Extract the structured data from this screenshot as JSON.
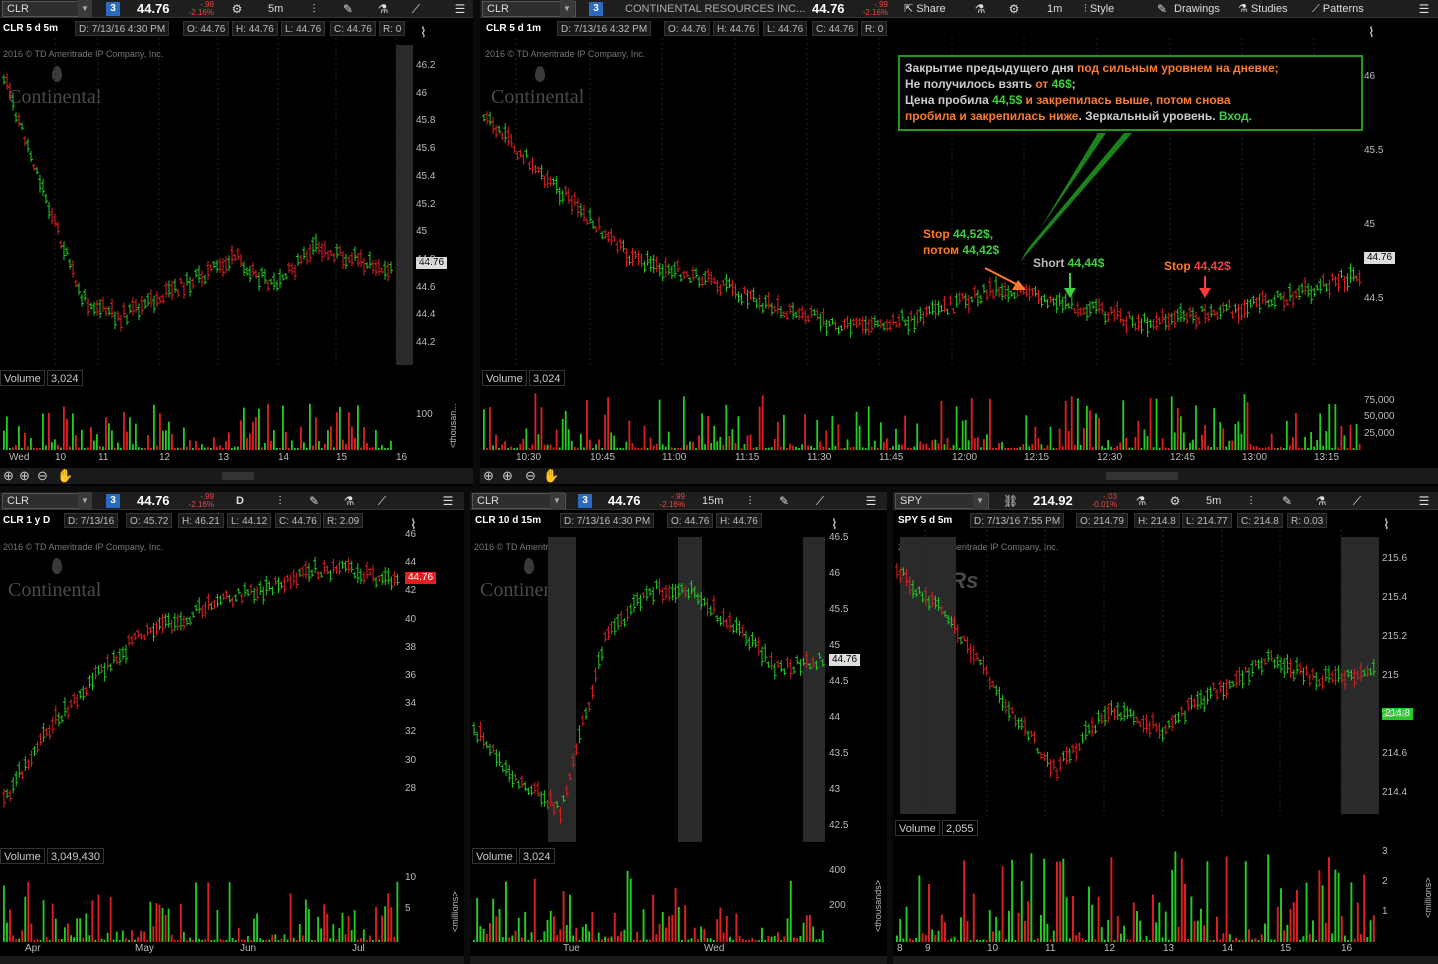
{
  "p1": {
    "symbol": "CLR",
    "link": "3",
    "price": "44.76",
    "chg1": "-.99",
    "chg2": "-2.16%",
    "tf": "5m",
    "label": "CLR 5 d 5m",
    "d": "D: 7/13/16 4:30 PM",
    "o": "O: 44.76",
    "h": "H: 44.76",
    "l": "L: 44.76",
    "c": "C: 44.76",
    "r": "R: 0",
    "copy": "2016 © TD Ameritrade IP Company, Inc.",
    "logo": "Continental",
    "yticks": [
      "46.2",
      "46",
      "45.8",
      "45.6",
      "45.4",
      "45.2",
      "45",
      "44.8",
      "44.6",
      "44.4",
      "44.2"
    ],
    "plabel": "44.76",
    "vol_label": "Volume",
    "vol_val": "3,024",
    "vol_ticks": [
      "100"
    ],
    "vol_unit": "<thousan...",
    "xlabels": [
      "Wed",
      "10",
      "11",
      "12",
      "13",
      "14",
      "15",
      "16"
    ]
  },
  "p2": {
    "symbol": "CLR",
    "link": "3",
    "company": "CONTINENTAL RESOURCES INC...",
    "price": "44.76",
    "chg1": "-.99",
    "chg2": "-2.16%",
    "menu": [
      "Share",
      "1m",
      "Style",
      "Drawings",
      "Studies",
      "Patterns"
    ],
    "label": "CLR 5 d 1m",
    "d": "D: 7/13/16 4:32 PM",
    "o": "O: 44.76",
    "h": "H: 44.76",
    "l": "L: 44.76",
    "c": "C: 44.76",
    "r": "R: 0",
    "copy": "2016 © TD Ameritrade IP Company, Inc.",
    "logo": "Continental",
    "yticks": [
      "46",
      "45.5",
      "45",
      "44.5"
    ],
    "plabel": "44.76",
    "vol_label": "Volume",
    "vol_val": "3,024",
    "vol_ticks": [
      "75,000",
      "50,000",
      "25,000"
    ],
    "xlabels": [
      "10:30",
      "10:45",
      "11:00",
      "11:15",
      "11:30",
      "11:45",
      "12:00",
      "12:15",
      "12:30",
      "12:45",
      "13:00",
      "13:15"
    ],
    "note": {
      "l1a": "Закрытие предыдущего дня ",
      "l1b": "под сильным уровнем на дневке;",
      "l2a": "Не получилось взять ",
      "l2b": "от ",
      "l2c": "46$",
      "l2d": ";",
      "l3a": "Цена пробила ",
      "l3b": "44,5$",
      "l3c": " и закрепилась выше, потом снова",
      "l4a": "пробила и закрепилась ниже",
      "l4b": ". Зеркальный уровень. ",
      "l4c": "Вход."
    },
    "stop1a": "Stop ",
    "stop1b": "44,52$,",
    "stop1c": "потом ",
    "stop1d": "44,42$",
    "short_a": "Short ",
    "short_b": "44,44$",
    "stop2a": "Stop ",
    "stop2b": "44,42$"
  },
  "p3": {
    "symbol": "CLR",
    "link": "3",
    "price": "44.76",
    "chg1": "-.99",
    "chg2": "-2.16%",
    "tf": "D",
    "label": "CLR 1 y D",
    "d": "D: 7/13/16",
    "o": "O: 45.72",
    "h": "H: 46.21",
    "l": "L: 44.12",
    "c": "C: 44.76",
    "r": "R: 2.09",
    "copy": "2016 © TD Ameritrade IP Company, Inc.",
    "logo": "Continental",
    "yticks": [
      "46",
      "44",
      "42",
      "40",
      "38",
      "36",
      "34",
      "32",
      "30",
      "28"
    ],
    "plabel": "44.76",
    "vol_label": "Volume",
    "vol_val": "3,049,430",
    "vol_ticks": [
      "10",
      "5"
    ],
    "vol_unit": "<millions>",
    "xlabels": [
      "Apr",
      "May",
      "Jun",
      "Jul"
    ]
  },
  "p4": {
    "symbol": "CLR",
    "link": "3",
    "price": "44.76",
    "chg1": "-.99",
    "chg2": "-2.16%",
    "tf": "15m",
    "label": "CLR 10 d 15m",
    "d": "D: 7/13/16 4:30 PM",
    "o": "O: 44.76",
    "h": "H: 44.76",
    "copy": "2016 © TD Ameritrade",
    "logo": "Continental",
    "yticks": [
      "46.5",
      "46",
      "45.5",
      "45",
      "44.5",
      "44",
      "43.5",
      "43",
      "42.5"
    ],
    "plabel": "44.76",
    "vol_label": "Volume",
    "vol_val": "3,024",
    "vol_ticks": [
      "400",
      "200"
    ],
    "vol_unit": "<thousands>",
    "xlabels": [
      "Tue",
      "Wed"
    ]
  },
  "p5": {
    "symbol": "SPY",
    "price": "214.92",
    "chg1": "-.03",
    "chg2": "-0.01%",
    "tf": "5m",
    "label": "SPY 5 d 5m",
    "d": "D: 7/13/16 7:55 PM",
    "o": "O: 214.79",
    "h": "H: 214.8",
    "l": "L: 214.77",
    "c": "C: 214.8",
    "r": "R: 0.03",
    "copy": "2016 © TD Ameritrade IP Company, Inc.",
    "logo": "SPDRs",
    "yticks": [
      "215.6",
      "215.4",
      "215.2",
      "215",
      "214.8",
      "214.6",
      "214.4"
    ],
    "plabel": "214.8",
    "vol_label": "Volume",
    "vol_val": "2,055",
    "vol_ticks": [
      "3",
      "2",
      "1"
    ],
    "vol_unit": "<millions>",
    "xlabels": [
      "8",
      "9",
      "10",
      "11",
      "12",
      "13",
      "14",
      "15",
      "16"
    ]
  },
  "colors": {
    "up": "#22cc22",
    "down": "#e02020",
    "note_border": "#1f9a1f",
    "orange": "#ff7a2a",
    "green": "#3ecf3e"
  }
}
